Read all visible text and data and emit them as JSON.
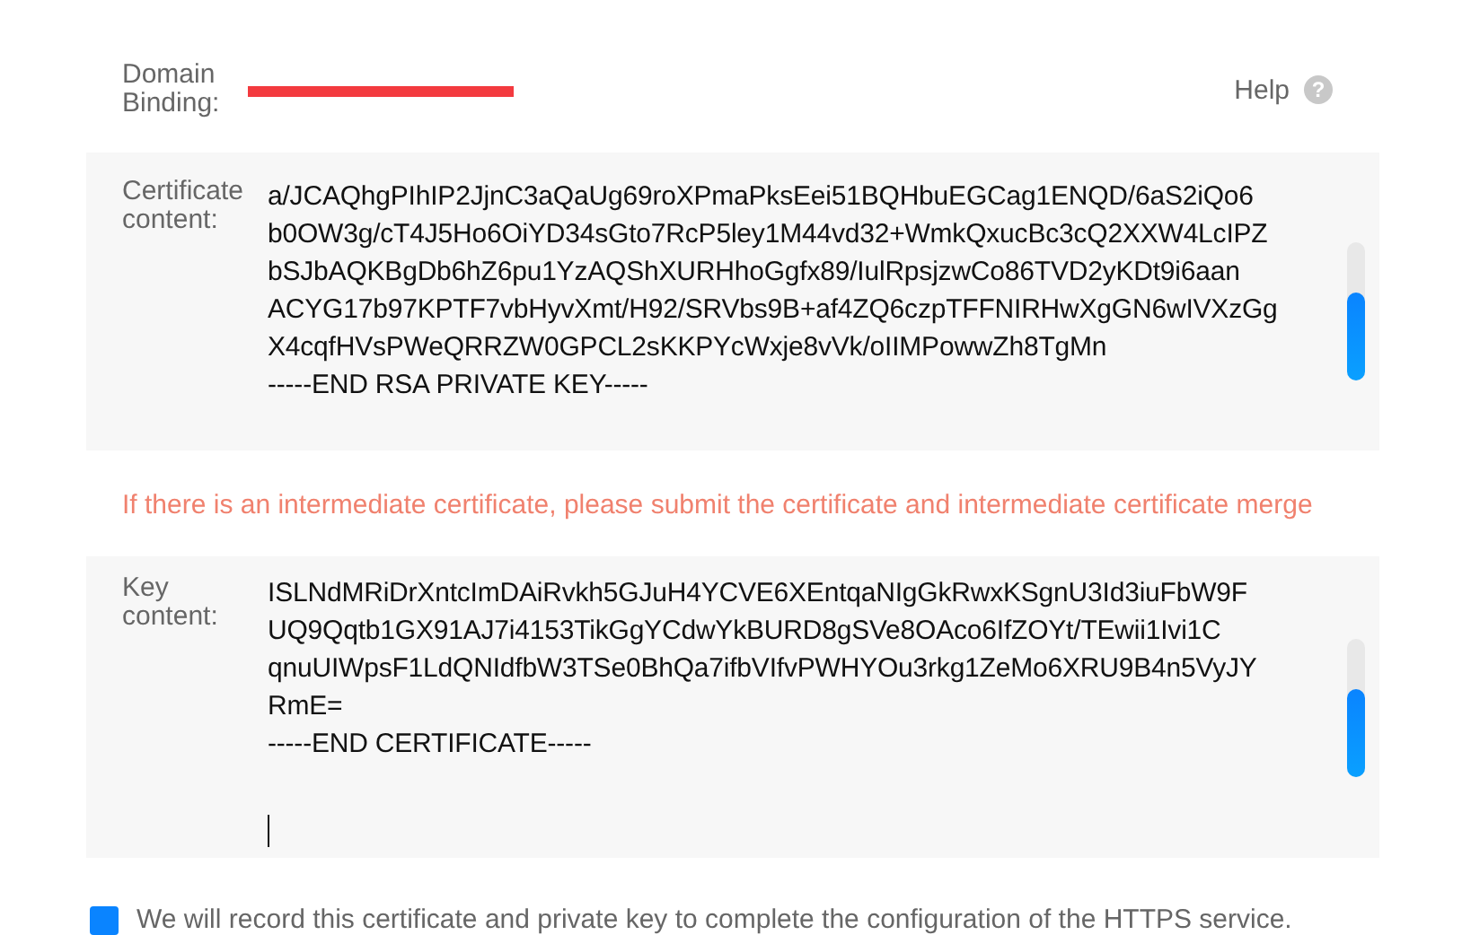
{
  "domain_binding": {
    "label": "Domain Binding:",
    "redacted": true
  },
  "help": {
    "label": "Help",
    "icon": "?"
  },
  "certificate": {
    "label": "Certificate content:",
    "lines": [
      "a/JCAQhgPIhIP2JjnC3aQaUg69roXPmaPksEei51BQHbuEGCag1ENQD/6aS2iQo6",
      "b0OW3g/cT4J5Ho6OiYD34sGto7RcP5ley1M44vd32+WmkQxucBc3cQ2XXW4LcIPZ",
      "bSJbAQKBgDb6hZ6pu1YzAQShXURHhoGgfx89/IulRpsjzwCo86TVD2yKDt9i6aan",
      "ACYG17b97KPTF7vbHyvXmt/H92/SRVbs9B+af4ZQ6czpTFFNIRHwXgGN6wIVXzGg",
      "X4cqfHVsPWeQRRZW0GPCL2sKKPYcWxje8vVk/oIIMPowwZh8TgMn",
      "-----END RSA PRIVATE KEY-----"
    ],
    "focused": false
  },
  "notice": "If there is an intermediate certificate, please submit the certificate and intermediate certificate merge",
  "key": {
    "label": "Key content:",
    "lines": [
      "ISLNdMRiDrXntcImDAiRvkh5GJuH4YCVE6XEntqaNIgGkRwxKSgnU3Id3iuFbW9F",
      "UQ9Qqtb1GX91AJ7i4153TikGgYCdwYkBURD8gSVe8OAco6IfZOYt/TEwii1Ivi1C",
      "qnuUIWpsF1LdQNIdfbW3TSe0BhQa7ifbVIfvPWHYOu3rkg1ZeMo6XRU9B4n5VyJY",
      "RmE=",
      "-----END CERTIFICATE-----"
    ],
    "focused": true
  },
  "agreement": {
    "checked": true,
    "text": "We will record this certificate and private key to complete the configuration of the HTTPS service."
  }
}
